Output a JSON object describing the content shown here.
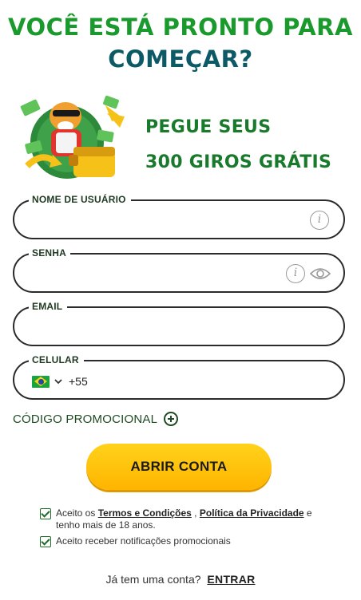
{
  "headline": {
    "line1": "VOCÊ ESTÁ PRONTO PARA",
    "line2": "COMEÇAR?"
  },
  "promo": {
    "line1": "PEGUE SEUS",
    "line2": "300 GIROS GRÁTIS",
    "image_icon": "tiger-mascot-with-wallet-icon"
  },
  "form": {
    "username": {
      "label": "NOME DE USUÁRIO",
      "value": "",
      "placeholder": ""
    },
    "password": {
      "label": "SENHA",
      "value": "",
      "placeholder": ""
    },
    "email": {
      "label": "EMAIL",
      "value": "",
      "placeholder": ""
    },
    "phone": {
      "label": "CELULAR",
      "country_code": "+55",
      "flag_icon": "brazil-flag-icon",
      "value": ""
    },
    "promo_code_label": "CÓDIGO PROMOCIONAL"
  },
  "cta_label": "ABRIR CONTA",
  "consents": {
    "terms": {
      "prefix": "Aceito os",
      "terms_link": "Termos e Condições",
      "separator": " , ",
      "privacy_link": "Política da Privacidade",
      "suffix": " e tenho mais de 18 anos.",
      "checked": true
    },
    "notifications": {
      "text": "Aceito receber notificações promocionais",
      "checked": true
    }
  },
  "login": {
    "prompt": "Já tem uma conta?",
    "link": "ENTRAR"
  },
  "colors": {
    "headline_green": "#1a9a2c",
    "headline_teal": "#0b5a66",
    "promo_green": "#1a7a2c",
    "cta_yellow": "#ffc20e",
    "checkbox_green": "#1f6b2a"
  }
}
